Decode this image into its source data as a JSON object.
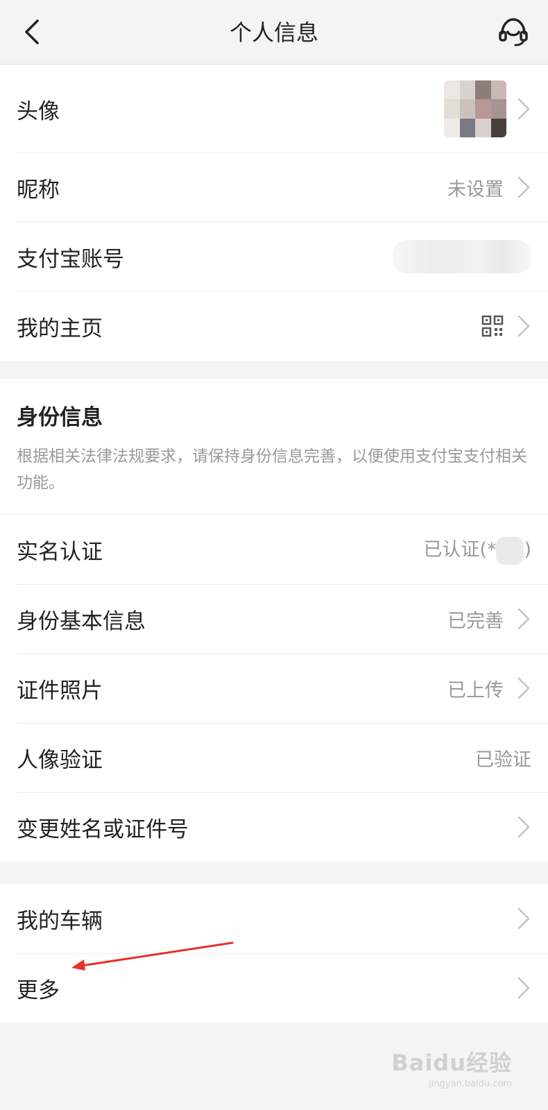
{
  "header": {
    "title": "个人信息",
    "back_icon": "chevron-left-icon",
    "service_icon": "headset-icon"
  },
  "profile": {
    "avatar_label": "头像",
    "nickname_label": "昵称",
    "nickname_value": "未设置",
    "account_label": "支付宝账号",
    "homepage_label": "我的主页"
  },
  "identity": {
    "title": "身份信息",
    "description": "根据相关法律法规要求，请保持身份信息完善，以便使用支付宝支付相关功能。",
    "realname_label": "实名认证",
    "realname_value": "已认证(*",
    "realname_value_end": ")",
    "basic_label": "身份基本信息",
    "basic_value": "已完善",
    "photo_label": "证件照片",
    "photo_value": "已上传",
    "face_label": "人像验证",
    "face_value": "已验证",
    "change_label": "变更姓名或证件号"
  },
  "other": {
    "vehicle_label": "我的车辆",
    "more_label": "更多"
  },
  "watermark": {
    "main": "Baidu经验",
    "sub": "jingyan.baidu.com"
  },
  "colors": {
    "background": "#f4f4f4",
    "annotation_arrow": "#e8302a",
    "secondary_text": "#999999"
  }
}
